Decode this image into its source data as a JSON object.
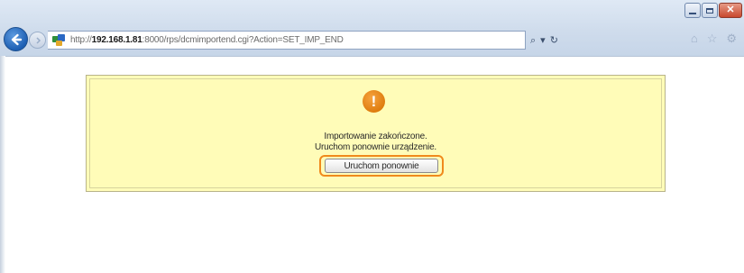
{
  "browser": {
    "url_prefix": "http://",
    "url_host": "192.168.1.81",
    "url_rest": ":8000/rps/dcmimportend.cgi?Action=SET_IMP_END",
    "search_icon": "search-icon",
    "refresh_icon": "refresh-icon"
  },
  "message": {
    "icon": "exclamation-icon",
    "line1": "Importowanie zakończone.",
    "line2": "Uruchom ponownie urządzenie.",
    "restart_button": "Uruchom ponownie",
    "highlight_color": "#f08a1c",
    "background_color": "#fffcb8"
  }
}
